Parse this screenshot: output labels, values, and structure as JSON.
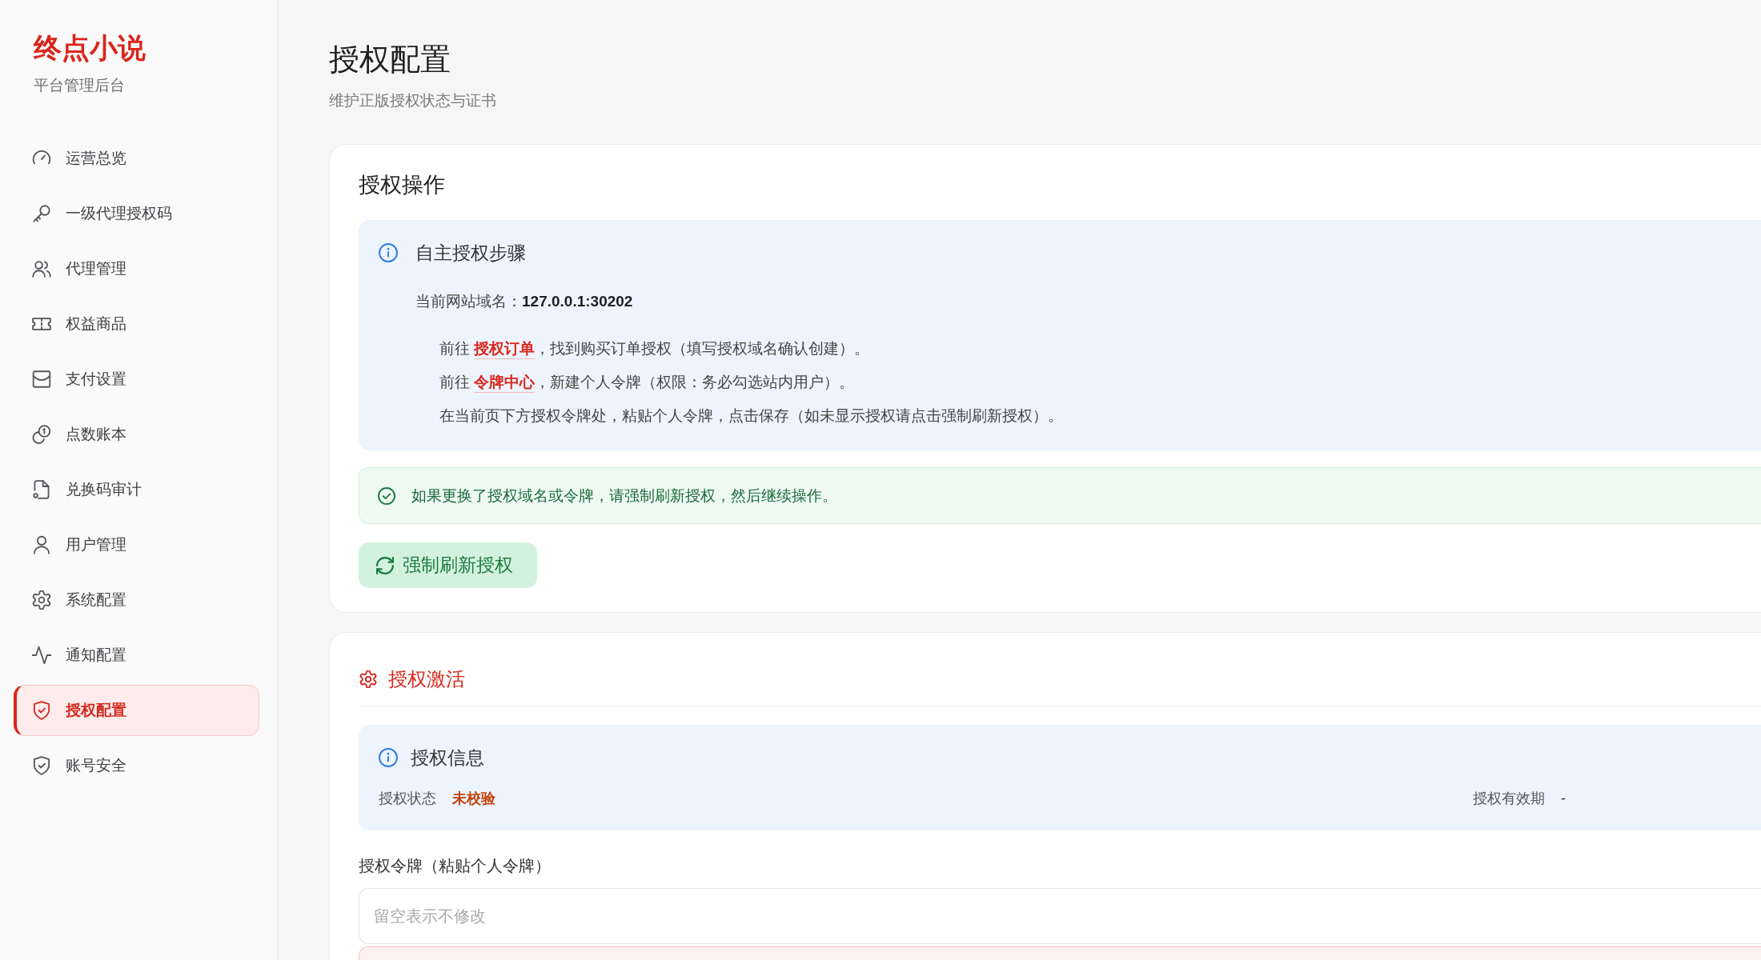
{
  "sidebar": {
    "brand": "终点小说",
    "subtitle": "平台管理后台",
    "items": [
      {
        "label": "运营总览",
        "selected": false
      },
      {
        "label": "一级代理授权码",
        "selected": false
      },
      {
        "label": "代理管理",
        "selected": false
      },
      {
        "label": "权益商品",
        "selected": false
      },
      {
        "label": "支付设置",
        "selected": false
      },
      {
        "label": "点数账本",
        "selected": false
      },
      {
        "label": "兑换码审计",
        "selected": false
      },
      {
        "label": "用户管理",
        "selected": false
      },
      {
        "label": "系统配置",
        "selected": false
      },
      {
        "label": "通知配置",
        "selected": false
      },
      {
        "label": "授权配置",
        "selected": true
      },
      {
        "label": "账号安全",
        "selected": false
      }
    ]
  },
  "page": {
    "title": "授权配置",
    "subtitle": "维护正版授权状态与证书"
  },
  "operations_card": {
    "title": "授权操作",
    "steps_panel": {
      "title": "自主授权步骤",
      "domain": "当前网站域名：**127.0.0.1:30202**",
      "steps": [
        {
          "before": "前往 ",
          "link": "授权订单",
          "after": "，找到购买订单授权（填写授权域名确认创建）。"
        },
        {
          "before": "前往 ",
          "link": "令牌中心",
          "after": "，新建个人令牌（权限：务必勾选站内用户）。"
        },
        {
          "before": "在当前页下方授权令牌处，粘贴个人令牌，点击保存（如未显示授权请点击强制刷新授权）。"
        }
      ]
    },
    "notice": "如果更换了授权域名或令牌，请强制刷新授权，然后继续操作。",
    "refresh_button": "强制刷新授权"
  },
  "activation_card": {
    "title": "授权激活",
    "info_panel": {
      "title": "授权信息",
      "status_label": "授权状态",
      "status_value": "未校验",
      "expiry_label": "授权有效期",
      "expiry_value": "-"
    },
    "token_field": {
      "label": "授权令牌（粘贴个人令牌）",
      "placeholder": "留空表示不修改"
    }
  }
}
